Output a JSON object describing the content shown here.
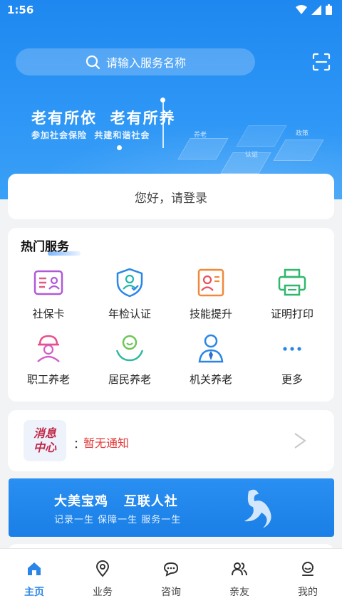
{
  "status": {
    "time": "1:56"
  },
  "search": {
    "placeholder": "请输入服务名称"
  },
  "banner": {
    "title": "老有所依  老有所养",
    "subtitle": "参加社会保险  共建和谐社会",
    "iso_labels": [
      "养老",
      "认证",
      "政策"
    ]
  },
  "login": {
    "text": "您好，请登录"
  },
  "services": {
    "title": "热门服务",
    "items": [
      {
        "label": "社保卡",
        "icon": "id-card-icon"
      },
      {
        "label": "年检认证",
        "icon": "shield-face-icon"
      },
      {
        "label": "技能提升",
        "icon": "certificate-icon"
      },
      {
        "label": "证明打印",
        "icon": "printer-icon"
      },
      {
        "label": "职工养老",
        "icon": "worker-helmet-icon"
      },
      {
        "label": "居民养老",
        "icon": "resident-hands-icon"
      },
      {
        "label": "机关养老",
        "icon": "official-tie-icon"
      },
      {
        "label": "更多",
        "icon": "more-dots-icon"
      }
    ]
  },
  "message": {
    "badge_line1": "消息",
    "badge_line2": "中心",
    "colon": "：",
    "text": "暂无通知"
  },
  "ad": {
    "title": "大美宝鸡   互联人社",
    "subtitle": "记录一生 保障一生 服务一生"
  },
  "tabs": [
    {
      "label": "主页",
      "icon": "home-icon",
      "active": true
    },
    {
      "label": "业务",
      "icon": "location-icon",
      "active": false
    },
    {
      "label": "咨询",
      "icon": "chat-icon",
      "active": false
    },
    {
      "label": "亲友",
      "icon": "friends-icon",
      "active": false
    },
    {
      "label": "我的",
      "icon": "profile-icon",
      "active": false
    }
  ],
  "colors": {
    "primary": "#2a86e6",
    "alert": "#e23b3b"
  }
}
